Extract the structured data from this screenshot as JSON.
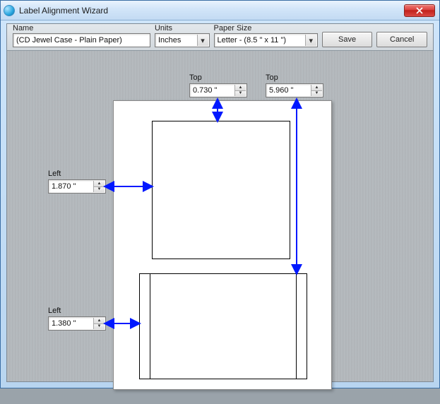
{
  "window": {
    "title": "Label Alignment Wizard"
  },
  "strip": {
    "name_label": "Name",
    "name_value": "(CD Jewel Case - Plain Paper)",
    "units_label": "Units",
    "units_value": "Inches",
    "paper_label": "Paper Size",
    "paper_value": "Letter - (8.5 \" x 11 \")",
    "save": "Save",
    "cancel": "Cancel"
  },
  "measure": {
    "top1_label": "Top",
    "top1_value": "0.730 \"",
    "top2_label": "Top",
    "top2_value": "5.960 \"",
    "left1_label": "Left",
    "left1_value": "1.870 \"",
    "left2_label": "Left",
    "left2_value": "1.380 \""
  }
}
